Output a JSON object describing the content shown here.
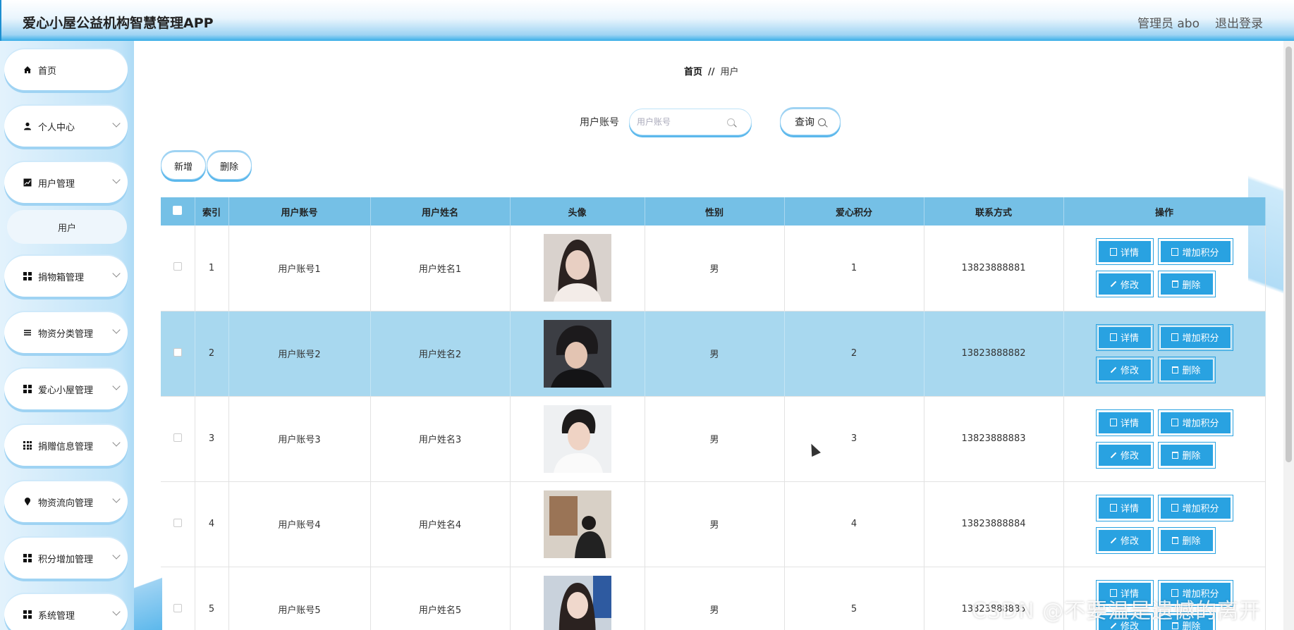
{
  "header": {
    "app_title": "爱心小屋公益机构智慧管理APP",
    "admin_label": "管理员 abo",
    "logout_label": "退出登录"
  },
  "sidebar": {
    "items": [
      {
        "label": "首页",
        "icon": "home-icon"
      },
      {
        "label": "个人中心",
        "icon": "user-icon"
      },
      {
        "label": "用户管理",
        "icon": "chart-icon"
      },
      {
        "label": "捐物箱管理",
        "icon": "grid-icon"
      },
      {
        "label": "物资分类管理",
        "icon": "list-icon"
      },
      {
        "label": "爱心小屋管理",
        "icon": "grid-icon"
      },
      {
        "label": "捐赠信息管理",
        "icon": "grid9-icon"
      },
      {
        "label": "物资流向管理",
        "icon": "pin-icon"
      },
      {
        "label": "积分增加管理",
        "icon": "grid-icon"
      },
      {
        "label": "系统管理",
        "icon": "grid-icon"
      }
    ],
    "sub_item": "用户"
  },
  "breadcrumb": {
    "home": "首页",
    "separator": "//",
    "current": "用户"
  },
  "search": {
    "label": "用户账号",
    "placeholder": "用户账号",
    "value": "",
    "button": "查询"
  },
  "actions": {
    "add": "新增",
    "delete": "删除"
  },
  "table": {
    "columns": [
      "索引",
      "用户账号",
      "用户姓名",
      "头像",
      "性别",
      "爱心积分",
      "联系方式",
      "操作"
    ],
    "rows": [
      {
        "index": "1",
        "account": "用户账号1",
        "name": "用户姓名1",
        "gender": "男",
        "points": "1",
        "phone": "13823888881"
      },
      {
        "index": "2",
        "account": "用户账号2",
        "name": "用户姓名2",
        "gender": "男",
        "points": "2",
        "phone": "13823888882"
      },
      {
        "index": "3",
        "account": "用户账号3",
        "name": "用户姓名3",
        "gender": "男",
        "points": "3",
        "phone": "13823888883"
      },
      {
        "index": "4",
        "account": "用户账号4",
        "name": "用户姓名4",
        "gender": "男",
        "points": "4",
        "phone": "13823888884"
      },
      {
        "index": "5",
        "account": "用户账号5",
        "name": "用户姓名5",
        "gender": "男",
        "points": "5",
        "phone": "13823888885"
      }
    ],
    "selected_row": 2,
    "op_labels": {
      "detail": "详情",
      "add_points": "增加积分",
      "edit": "修改",
      "delete": "删除"
    }
  },
  "watermark": "CSDN @不要温是遗憾的离开",
  "colors": {
    "accent": "#29a2e1",
    "header_blue": "#75c0e6",
    "selected_row": "#a8d8ef"
  }
}
